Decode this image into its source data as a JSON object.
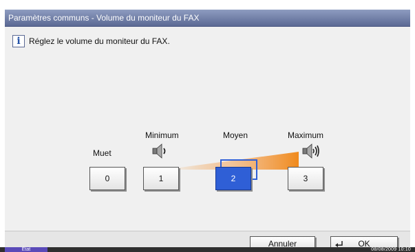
{
  "window": {
    "title": "Paramètres communs - Volume du moniteur du FAX"
  },
  "info": {
    "message": "Réglez le volume du moniteur du FAX."
  },
  "levels": {
    "mute_label": "Muet",
    "minimum_label": "Minimum",
    "medium_label": "Moyen",
    "maximum_label": "Maximum",
    "keys": [
      "0",
      "1",
      "2",
      "3"
    ],
    "selected": "2"
  },
  "footer": {
    "cancel_label": "Annuler",
    "ok_label": "OK"
  },
  "status": {
    "tab_label": "État",
    "datetime": "08/08/2009   10:10"
  },
  "colors": {
    "accent": "#2f5fd6",
    "ramp": "#f08a1c",
    "title_bar": "#6f7ca8"
  }
}
